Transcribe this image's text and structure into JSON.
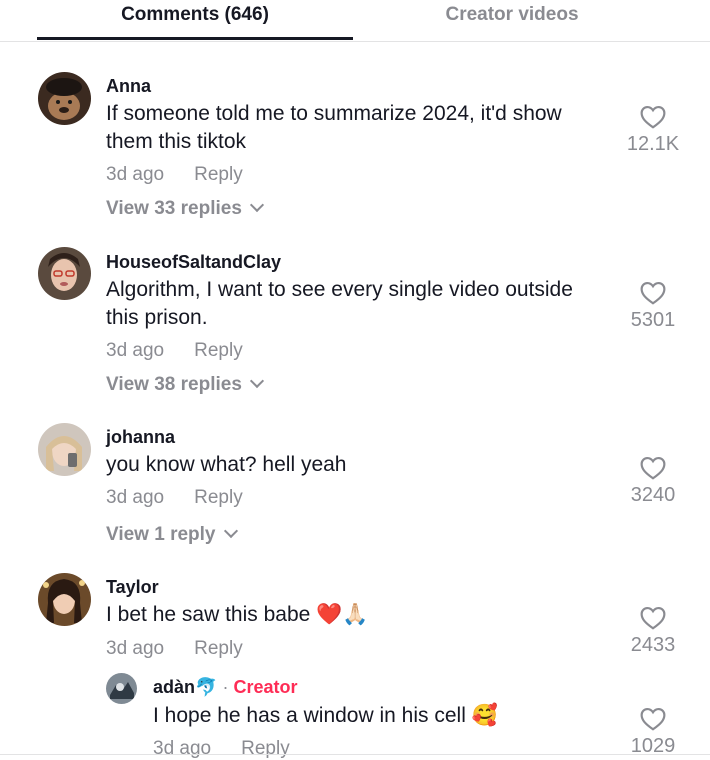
{
  "tabs": {
    "comments": "Comments (646)",
    "creator_videos": "Creator videos"
  },
  "icons": {
    "like": "heart-outline-icon",
    "expand": "chevron-down-icon"
  },
  "comments": [
    {
      "username": "Anna",
      "text": "If someone told me to summarize 2024, it'd show them this tiktok",
      "time": "3d ago",
      "reply_label": "Reply",
      "likes": "12.1K",
      "view_replies": "View 33 replies"
    },
    {
      "username": "HouseofSaltandClay",
      "text": "Algorithm, I want to see every single video outside this prison.",
      "time": "3d ago",
      "reply_label": "Reply",
      "likes": "5301",
      "view_replies": "View 38 replies"
    },
    {
      "username": "johanna",
      "text": "you know what? hell yeah",
      "time": "3d ago",
      "reply_label": "Reply",
      "likes": "3240",
      "view_replies": "View 1 reply"
    },
    {
      "username": "Taylor",
      "text": "I bet he saw this babe ❤️🙏🏻",
      "time": "3d ago",
      "reply_label": "Reply",
      "likes": "2433"
    }
  ],
  "reply": {
    "username": "adàn🐬",
    "separator": "·",
    "creator_label": "Creator",
    "text": "I hope he has a window in his cell 🥰",
    "time": "3d ago",
    "reply_label": "Reply",
    "likes": "1029"
  }
}
